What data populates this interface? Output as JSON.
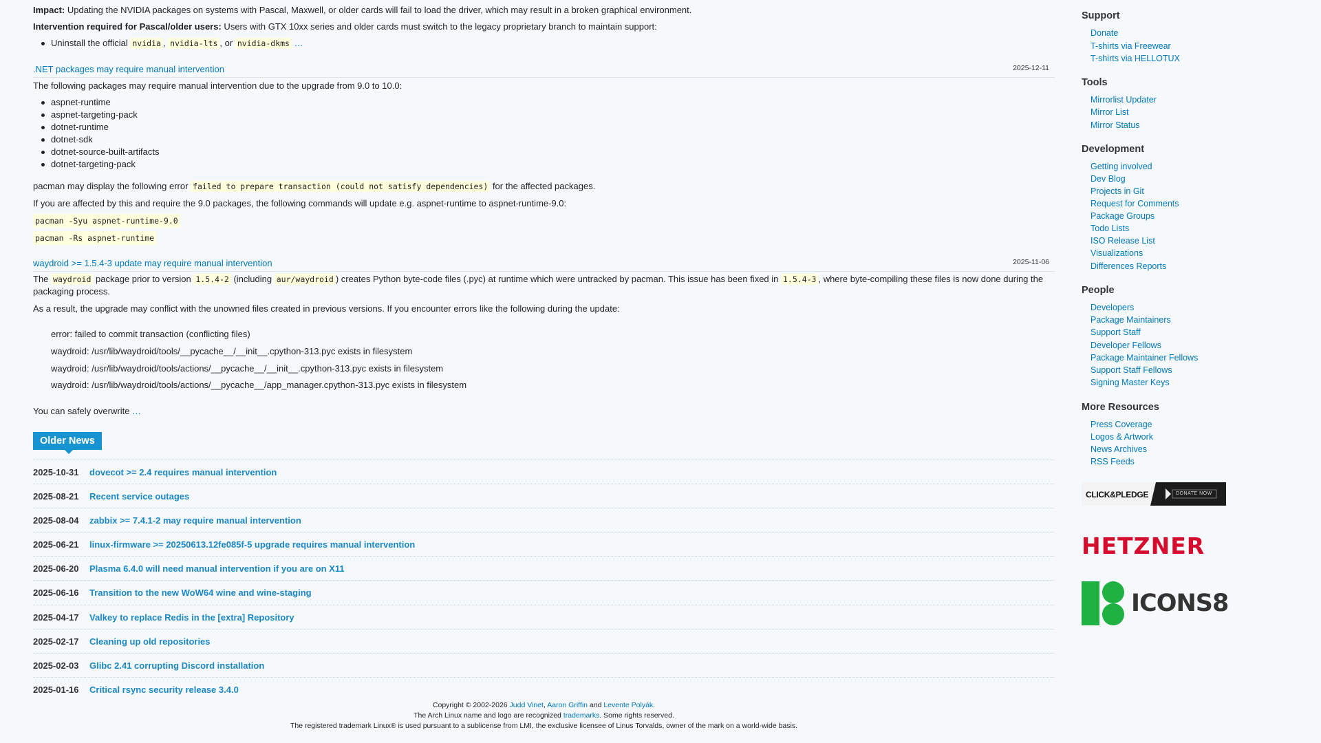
{
  "intro": {
    "impact_label": "Impact:",
    "impact_text": " Updating the NVIDIA packages on systems with Pascal, Maxwell, or older cards will fail to load the driver, which may result in a broken graphical environment.",
    "intervention_label": "Intervention required for Pascal/older users:",
    "intervention_text": " Users with GTX 10xx series and older cards must switch to the legacy proprietary branch to maintain support:",
    "uninstall_prefix": "Uninstall the official ",
    "pkg1": "nvidia",
    "sep1": ", ",
    "pkg2": "nvidia-lts",
    "sep2": ", or ",
    "pkg3": "nvidia-dkms",
    "more": " …"
  },
  "dotnet": {
    "title": ".NET packages may require manual intervention",
    "date": "2025-12-11",
    "intro": "The following packages may require manual intervention due to the upgrade from 9.0 to 10.0:",
    "packages": [
      "aspnet-runtime",
      "aspnet-targeting-pack",
      "dotnet-runtime",
      "dotnet-sdk",
      "dotnet-source-built-artifacts",
      "dotnet-targeting-pack"
    ],
    "error_prefix": "pacman may display the following error ",
    "error_code": "failed to prepare transaction (could not satisfy dependencies)",
    "error_suffix": " for the affected packages.",
    "affected_text": "If you are affected by this and require the 9.0 packages, the following commands will update e.g. aspnet-runtime to aspnet-runtime-9.0:",
    "cmd1": "pacman -Syu aspnet-runtime-9.0",
    "cmd2": "pacman -Rs aspnet-runtime"
  },
  "waydroid": {
    "title": "waydroid >= 1.5.4-3 update may require manual intervention",
    "date": "2025-11-06",
    "p1_a": "The ",
    "p1_code1": "waydroid",
    "p1_b": " package prior to version ",
    "p1_code2": "1.5.4-2",
    "p1_c": " (including ",
    "p1_code3": "aur/waydroid",
    "p1_d": ") creates Python byte-code files (.pyc) at runtime which were untracked by pacman. This issue has been fixed in ",
    "p1_code4": "1.5.4-3",
    "p1_e": ", where byte-compiling these files is now done during the packaging process.",
    "p2": "As a result, the upgrade may conflict with the unowned files created in previous versions. If you encounter errors like the following during the update:",
    "errors": [
      "error: failed to commit transaction (conflicting files)",
      "waydroid: /usr/lib/waydroid/tools/__pycache__/__init__.cpython-313.pyc exists in filesystem",
      "waydroid: /usr/lib/waydroid/tools/actions/__pycache__/__init__.cpython-313.pyc exists in filesystem",
      "waydroid: /usr/lib/waydroid/tools/actions/__pycache__/app_manager.cpython-313.pyc exists in filesystem"
    ],
    "p3_text": "You can safely overwrite ",
    "p3_more": "…"
  },
  "older_news": {
    "heading": "Older News",
    "items": [
      {
        "date": "2025-10-31",
        "title": "dovecot >= 2.4 requires manual intervention"
      },
      {
        "date": "2025-08-21",
        "title": "Recent service outages"
      },
      {
        "date": "2025-08-04",
        "title": "zabbix >= 7.4.1-2 may require manual intervention"
      },
      {
        "date": "2025-06-21",
        "title": "linux-firmware >= 20250613.12fe085f-5 upgrade requires manual intervention"
      },
      {
        "date": "2025-06-20",
        "title": "Plasma 6.4.0 will need manual intervention if you are on X11"
      },
      {
        "date": "2025-06-16",
        "title": "Transition to the new WoW64 wine and wine-staging"
      },
      {
        "date": "2025-04-17",
        "title": "Valkey to replace Redis in the [extra] Repository"
      },
      {
        "date": "2025-02-17",
        "title": "Cleaning up old repositories"
      },
      {
        "date": "2025-02-03",
        "title": "Glibc 2.41 corrupting Discord installation"
      },
      {
        "date": "2025-01-16",
        "title": "Critical rsync security release 3.4.0"
      }
    ]
  },
  "footer": {
    "copyright_prefix": "Copyright © 2002-2026 ",
    "author1": "Judd Vinet",
    "comma": ", ",
    "author2": "Aaron Griffin",
    "and": " and ",
    "author3": "Levente Polyák",
    "period": ".",
    "trademark_prefix": "The Arch Linux name and logo are recognized ",
    "trademark_link": "trademarks",
    "trademark_suffix": ". Some rights reserved.",
    "linux_text": "The registered trademark Linux® is used pursuant to a sublicense from LMI, the exclusive licensee of Linus Torvalds, owner of the mark on a world-wide basis."
  },
  "sidebar": {
    "sections": [
      {
        "heading": "Support",
        "links": [
          "Donate",
          "T-shirts via Freewear",
          "T-shirts via HELLOTUX"
        ]
      },
      {
        "heading": "Tools",
        "links": [
          "Mirrorlist Updater",
          "Mirror List",
          "Mirror Status"
        ]
      },
      {
        "heading": "Development",
        "links": [
          "Getting involved",
          "Dev Blog",
          "Projects in Git",
          "Request for Comments",
          "Package Groups",
          "Todo Lists",
          "ISO Release List",
          "Visualizations",
          "Differences Reports"
        ]
      },
      {
        "heading": "People",
        "links": [
          "Developers",
          "Package Maintainers",
          "Support Staff",
          "Developer Fellows",
          "Package Maintainer Fellows",
          "Support Staff Fellows",
          "Signing Master Keys"
        ]
      },
      {
        "heading": "More Resources",
        "links": [
          "Press Coverage",
          "Logos & Artwork",
          "News Archives",
          "RSS Feeds"
        ]
      }
    ],
    "sponsors": {
      "clickpledge": "CLICK&PLEDGE",
      "clickpledge_btn": "DONATE NOW",
      "hetzner": "HETZNER",
      "icons8": "ICONS8"
    }
  },
  "colors": {
    "link": "#0077bb",
    "accent": "#1793d1",
    "background": "#f6f9fc",
    "hetzner": "#d50c2d",
    "icons8_green": "#1fb141"
  }
}
